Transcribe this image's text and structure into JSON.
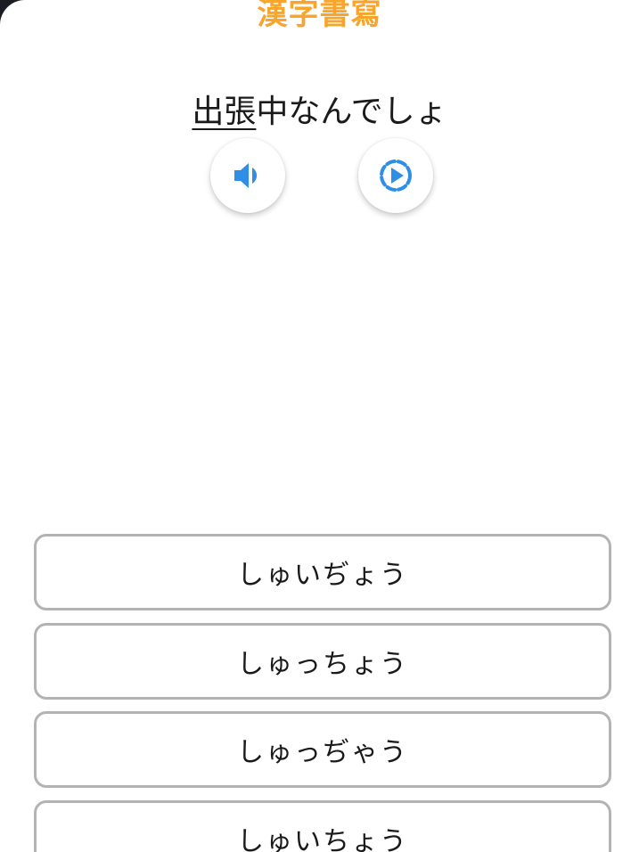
{
  "header": {
    "title": "漢字書寫"
  },
  "question": {
    "target_word": "出張",
    "rest_of_sentence": "中なんでしょ"
  },
  "audio": {
    "normal_icon": "speaker-icon",
    "slow_icon": "slow-play-icon",
    "accent_color": "#2f8fe6"
  },
  "options": [
    {
      "label": "しゅいぢょう"
    },
    {
      "label": "しゅっちょう"
    },
    {
      "label": "しゅっぢゃう"
    },
    {
      "label": "しゅいちょう"
    }
  ],
  "colors": {
    "title": "#f7a52d",
    "option_border": "#b3b3b3"
  }
}
